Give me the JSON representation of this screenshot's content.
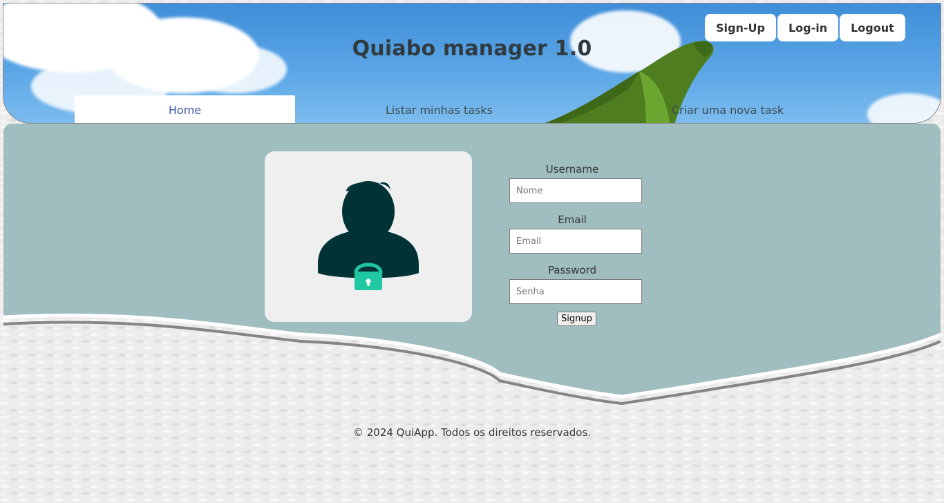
{
  "header": {
    "title": "Quiabo manager 1.0",
    "auth": {
      "signup": "Sign-Up",
      "login": "Log-in",
      "logout": "Logout"
    },
    "tabs": [
      {
        "label": "Home",
        "active": true
      },
      {
        "label": "Listar minhas tasks",
        "active": false
      },
      {
        "label": "Criar uma nova task",
        "active": false
      }
    ]
  },
  "form": {
    "username_label": "Username",
    "username_placeholder": "Nome",
    "email_label": "Email",
    "email_placeholder": "Email",
    "password_label": "Password",
    "password_placeholder": "Senha",
    "submit_label": "Signup"
  },
  "footer": {
    "text": "© 2024 QuiApp. Todos os direitos reservados."
  },
  "colors": {
    "sky": "#4a9ae0",
    "panel": "#a0bdbf",
    "avatar": "#003236",
    "lock": "#1fc8a2",
    "active_tab_text": "#3a5aa8"
  },
  "icons": {
    "avatar": "user-lock-icon",
    "logo": "okra-icon"
  }
}
